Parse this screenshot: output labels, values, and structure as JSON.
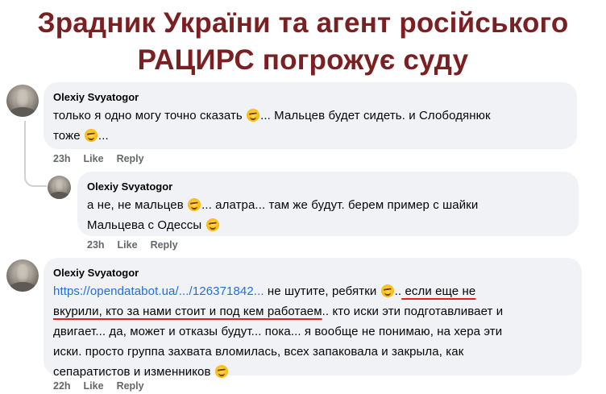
{
  "headline": {
    "line1": "Зрадник України та агент російського",
    "line2": "РАЦИРС погрожує суду"
  },
  "comments": [
    {
      "author": "Olexiy Svyatogor",
      "text_a": "только я одно могу точно сказать ",
      "text_b": "... Мальцев будет сидеть. и Слободянюк",
      "text_c": "тоже ",
      "text_d": "...",
      "time": "23h",
      "like": "Like",
      "reply": "Reply"
    },
    {
      "author": "Olexiy Svyatogor",
      "text_a": "а не, не мальцев ",
      "text_b": "... алатра... там же будут. берем пример с шайки",
      "text_c": "Мальцева с Одессы ",
      "time": "23h",
      "like": "Like",
      "reply": "Reply"
    },
    {
      "author": "Olexiy Svyatogor",
      "link": "https://opendatabot.ua/.../126371842...",
      "text_a": " не шутите, ребятки ",
      "text_b": "..",
      "underlined_1": " если еще не",
      "underlined_2": "вкурили, кто за нами стоит и под кем работаем",
      "text_c": ".. кто иски эти подготавливает и",
      "text_d": "двигает... да, может и отказы будут... пока... я вообще не понимаю, на хера эти",
      "text_e": "иски. просто группа захвата вломилась, всех запаковала и закрыла, как",
      "text_f": "сепаратистов и изменников ",
      "time": "22h",
      "like": "Like",
      "reply": "Reply"
    }
  ],
  "colors": {
    "headline": "#7a1f22",
    "bubble": "#f0f2f5",
    "link": "#216fdb",
    "underline": "#e0211f",
    "meta": "#65676b"
  },
  "icons": [
    "avatar-photo",
    "wink-emoji"
  ]
}
